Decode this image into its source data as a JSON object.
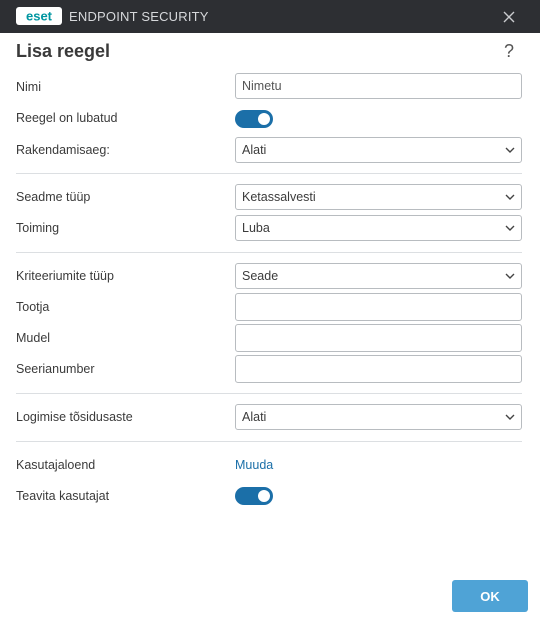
{
  "window": {
    "brand": "eset",
    "product_name": "ENDPOINT SECURITY",
    "close_icon": "close-icon"
  },
  "dialog": {
    "title": "Lisa reegel",
    "help_label": "?"
  },
  "form": {
    "name": {
      "label": "Nimi",
      "value": "Nimetu"
    },
    "enabled": {
      "label": "Reegel on lubatud",
      "on": true
    },
    "schedule": {
      "label": "Rakendamisaeg:",
      "value": "Alati"
    },
    "device_type": {
      "label": "Seadme tüüp",
      "value": "Ketassalvesti"
    },
    "action": {
      "label": "Toiming",
      "value": "Luba"
    },
    "criteria_type": {
      "label": "Kriteeriumite tüüp",
      "value": "Seade"
    },
    "vendor": {
      "label": "Tootja",
      "value": ""
    },
    "model": {
      "label": "Mudel",
      "value": ""
    },
    "serial": {
      "label": "Seerianumber",
      "value": ""
    },
    "log_severity": {
      "label": "Logimise tõsidusaste",
      "value": "Alati"
    },
    "user_list": {
      "label": "Kasutajaloend",
      "link": "Muuda"
    },
    "notify_user": {
      "label": "Teavita kasutajat",
      "on": true
    }
  },
  "footer": {
    "ok_label": "OK"
  },
  "colors": {
    "titlebar": "#2d2f33",
    "accent": "#1b6fa8",
    "ok_button": "#4fa3d6",
    "brand_teal": "#0096a1"
  }
}
